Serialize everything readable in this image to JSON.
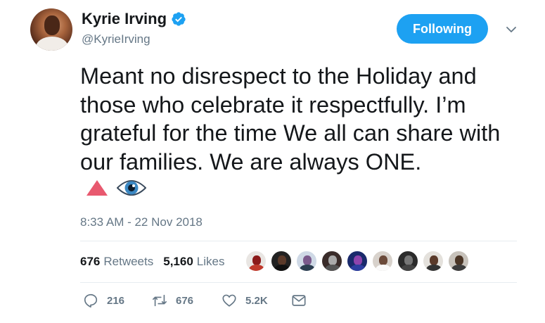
{
  "user": {
    "display_name": "Kyrie Irving",
    "handle": "@KyrieIrving",
    "verified": true
  },
  "follow_button": {
    "label": "Following"
  },
  "tweet": {
    "text": "Meant no disrespect to the Holiday and those who celebrate it respectfully.  I’m grateful for the time We all can share with our families. We are always ONE.",
    "emojis": [
      "red-triangle-up-icon",
      "eye-icon"
    ],
    "timestamp": "8:33 AM - 22 Nov 2018"
  },
  "stats": {
    "retweets_count": "676",
    "retweets_label": "Retweets",
    "likes_count": "5,160",
    "likes_label": "Likes"
  },
  "actions": {
    "reply_count": "216",
    "retweet_count": "676",
    "like_count": "5.2K"
  },
  "colors": {
    "accent": "#1da1f2",
    "secondary_text": "#657786",
    "primary_text": "#14171a",
    "divider": "#e6ecf0",
    "triangle": "#e8596f"
  }
}
